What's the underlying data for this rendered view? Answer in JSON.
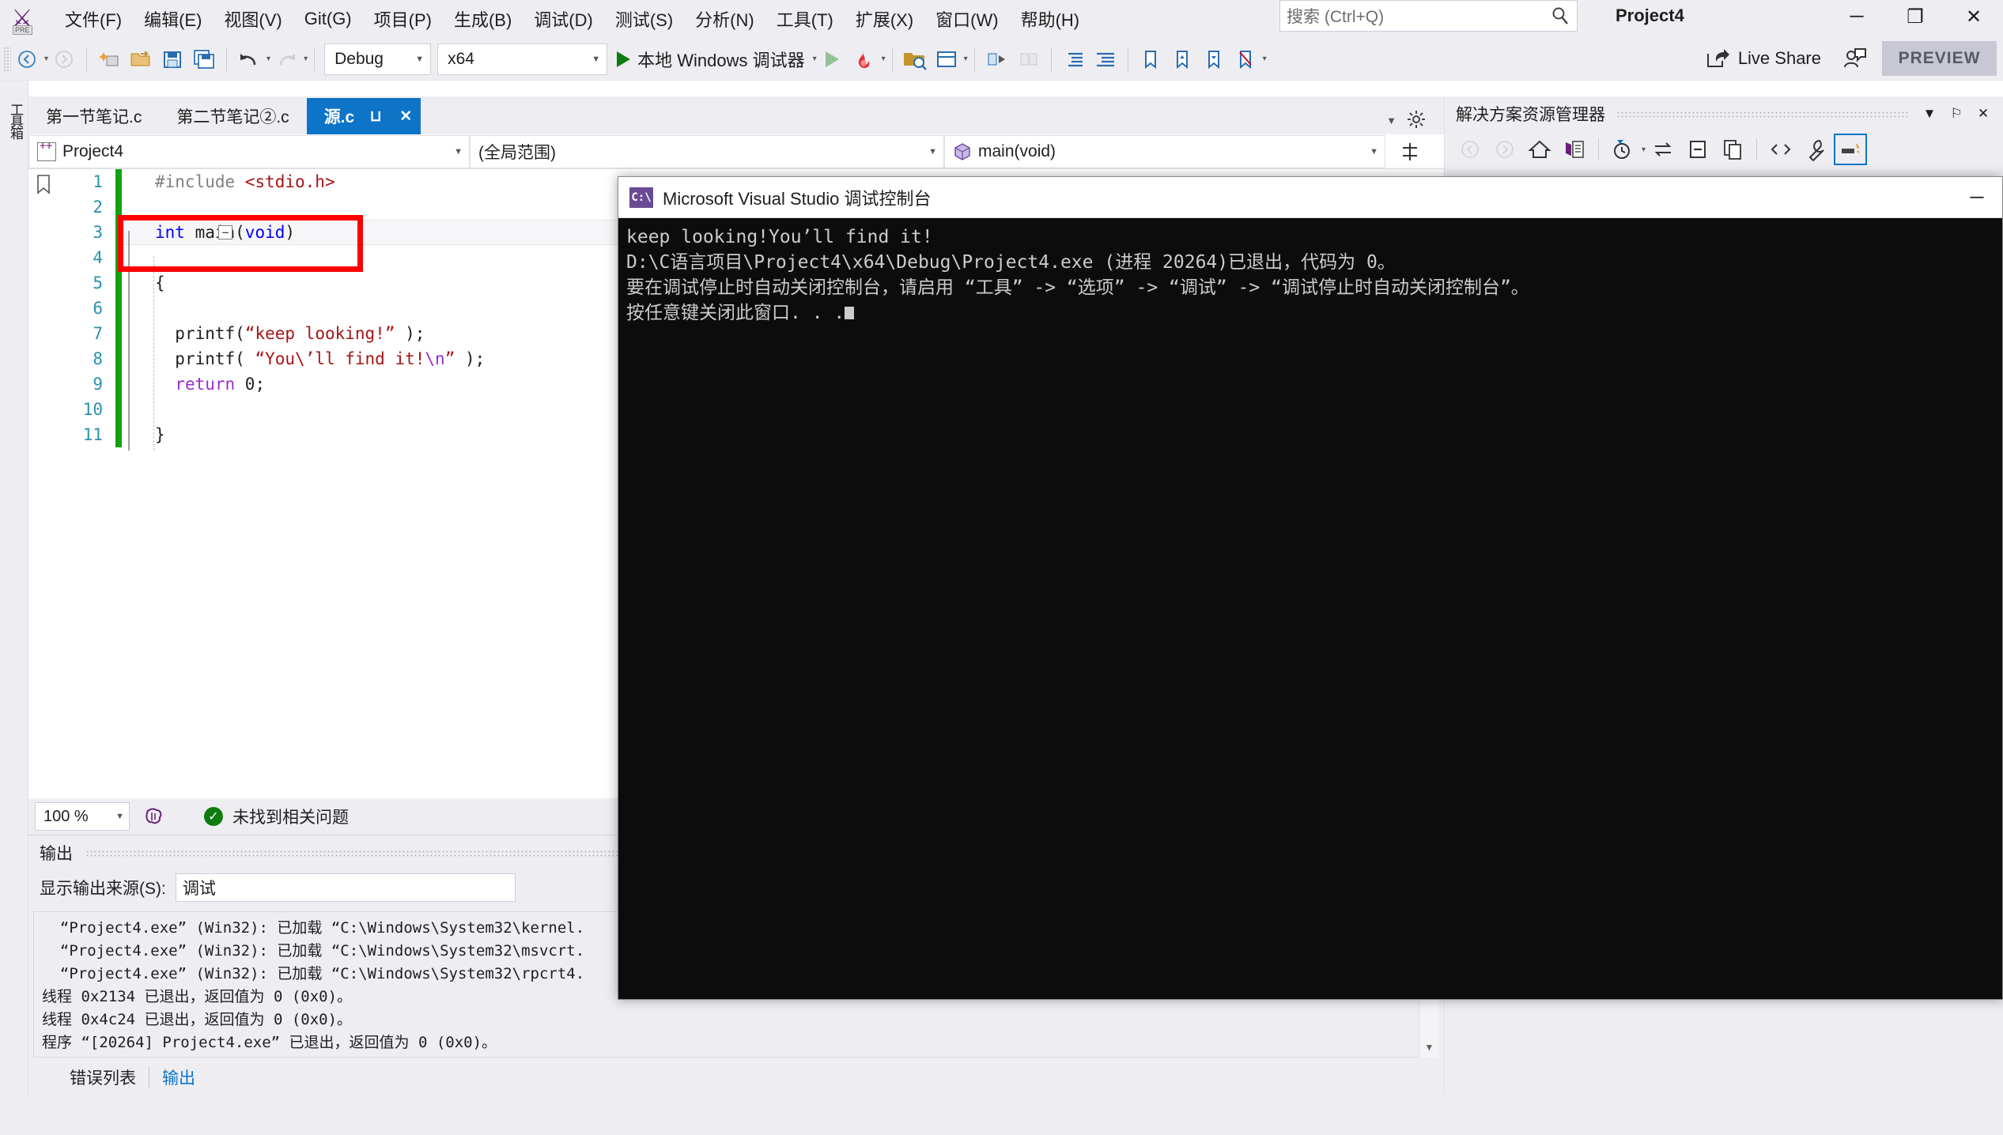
{
  "window": {
    "title": "Project4",
    "minimize_label": "─",
    "maximize_label": "❐",
    "close_label": "✕",
    "preview_badge": "PREVIEW"
  },
  "menu": {
    "items": [
      {
        "label": "文件(F)",
        "name": "menu-file"
      },
      {
        "label": "编辑(E)",
        "name": "menu-edit"
      },
      {
        "label": "视图(V)",
        "name": "menu-view"
      },
      {
        "label": "Git(G)",
        "name": "menu-git"
      },
      {
        "label": "项目(P)",
        "name": "menu-project"
      },
      {
        "label": "生成(B)",
        "name": "menu-build"
      },
      {
        "label": "调试(D)",
        "name": "menu-debug"
      },
      {
        "label": "测试(S)",
        "name": "menu-test"
      },
      {
        "label": "分析(N)",
        "name": "menu-analyze"
      },
      {
        "label": "工具(T)",
        "name": "menu-tools"
      },
      {
        "label": "扩展(X)",
        "name": "menu-extensions"
      },
      {
        "label": "窗口(W)",
        "name": "menu-window"
      },
      {
        "label": "帮助(H)",
        "name": "menu-help"
      }
    ]
  },
  "search": {
    "placeholder": "搜索 (Ctrl+Q)",
    "value": ""
  },
  "toolbar": {
    "configuration": "Debug",
    "platform": "x64",
    "run_label": "本地 Windows 调试器",
    "live_share": "Live Share",
    "logo_pre": "PRE"
  },
  "tabs": [
    {
      "label": "第一节笔记.c",
      "active": false
    },
    {
      "label": "第二节笔记②.c",
      "active": false
    },
    {
      "label": "源.c",
      "active": true
    }
  ],
  "navbar": {
    "project": "Project4",
    "scope": "(全局范围)",
    "member": "main(void)"
  },
  "editor": {
    "lines": [
      {
        "num": "1",
        "tokens": [
          {
            "t": "#include ",
            "c": "pp"
          },
          {
            "t": "<stdio.h>",
            "c": "inc"
          }
        ]
      },
      {
        "num": "2",
        "tokens": []
      },
      {
        "num": "3",
        "tokens": [
          {
            "t": "int ",
            "c": "kw"
          },
          {
            "t": "main",
            "c": "num"
          },
          {
            "t": "(",
            "c": "num"
          },
          {
            "t": "void",
            "c": "kw"
          },
          {
            "t": ")",
            "c": "num"
          }
        ]
      },
      {
        "num": "4",
        "tokens": []
      },
      {
        "num": "5",
        "tokens": [
          {
            "t": "{",
            "c": "num"
          }
        ]
      },
      {
        "num": "6",
        "tokens": []
      },
      {
        "num": "7",
        "tokens": [
          {
            "t": "  printf",
            "c": "num"
          },
          {
            "t": "(",
            "c": "num"
          },
          {
            "t": "“keep looking!”",
            "c": "str"
          },
          {
            "t": " );",
            "c": "num"
          }
        ]
      },
      {
        "num": "8",
        "tokens": [
          {
            "t": "  printf",
            "c": "num"
          },
          {
            "t": "( ",
            "c": "num"
          },
          {
            "t": "“You\\’ll find it!",
            "c": "str"
          },
          {
            "t": "\\n",
            "c": "esc"
          },
          {
            "t": "”",
            "c": "str"
          },
          {
            "t": " );",
            "c": "num"
          }
        ]
      },
      {
        "num": "9",
        "tokens": [
          {
            "t": "  return ",
            "c": "kw2"
          },
          {
            "t": "0;",
            "c": "num"
          }
        ]
      },
      {
        "num": "10",
        "tokens": []
      },
      {
        "num": "11",
        "tokens": [
          {
            "t": "}",
            "c": "num"
          }
        ]
      }
    ],
    "zoom": "100 %",
    "issue_status": "未找到相关问题"
  },
  "output": {
    "panel_title": "输出",
    "source_label": "显示输出来源(S):",
    "source_value": "调试",
    "lines": [
      "  “Project4.exe” (Win32): 已加载 “C:\\Windows\\System32\\kernel.",
      "  “Project4.exe” (Win32): 已加载 “C:\\Windows\\System32\\msvcrt.",
      "  “Project4.exe” (Win32): 已加载 “C:\\Windows\\System32\\rpcrt4.",
      "线程 0x2134 已退出，返回值为 0 (0x0)。",
      "线程 0x4c24 已退出，返回值为 0 (0x0)。",
      "程序 “[20264] Project4.exe” 已退出，返回值为 0 (0x0)。"
    ],
    "tabs": [
      {
        "label": "错误列表",
        "active": false
      },
      {
        "label": "输出",
        "active": true
      }
    ]
  },
  "solution_explorer": {
    "title": "解决方案资源管理器",
    "dropdown_label": "▼",
    "pin_label": "⚐",
    "close_label": "✕"
  },
  "console": {
    "title": "Microsoft Visual Studio 调试控制台",
    "icon_text": "C:\\",
    "minimize_label": "─",
    "lines": [
      "keep looking!You’ll find it!",
      "",
      "",
      "D:\\C语言项目\\Project4\\x64\\Debug\\Project4.exe (进程 20264)已退出，代码为 0。",
      "要在调试停止时自动关闭控制台，请启用 “工具” -> “选项” -> “调试” -> “调试停止时自动关闭控制台”。",
      "按任意键关闭此窗口. . ."
    ]
  },
  "left_strip": {
    "vertical_label": "工具箱"
  },
  "colors": {
    "accent": "#0d74c8",
    "chrome": "#eeeef2",
    "change_bar": "#11a111",
    "red_highlight": "#ff0000",
    "console_bg": "#0c0c0c",
    "keyword": "#0000ff",
    "string": "#a31515"
  }
}
